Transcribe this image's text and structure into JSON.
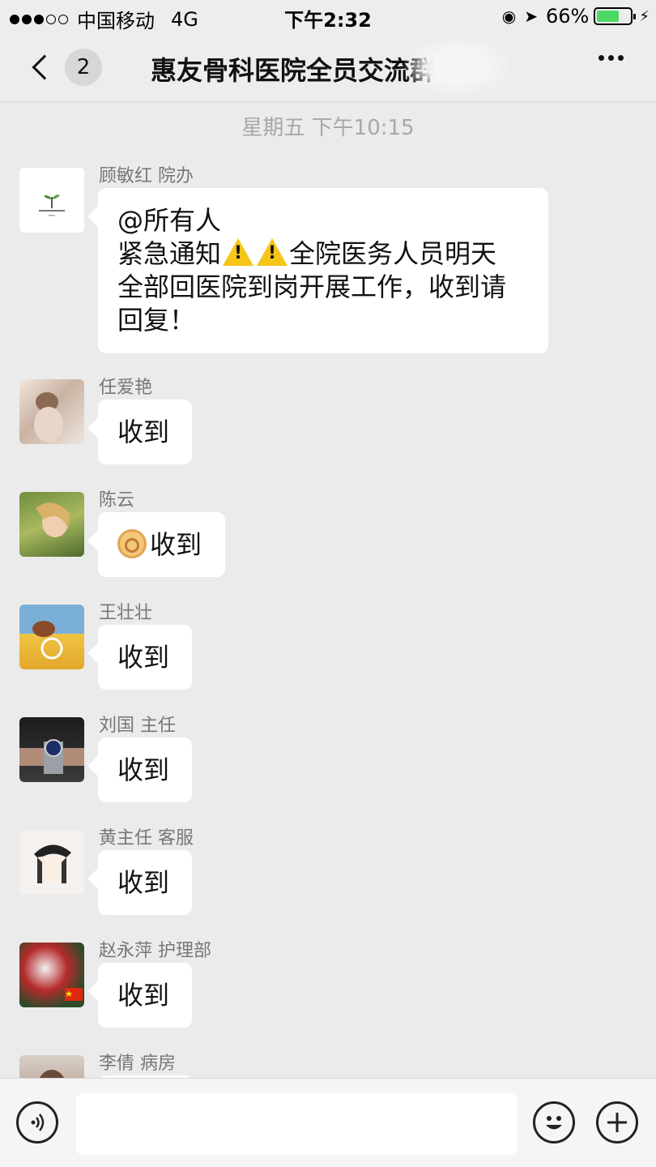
{
  "status_bar": {
    "signal_dots_filled": 3,
    "signal_dots_total": 5,
    "carrier": "中国移动",
    "network": "4G",
    "time": "下午2:32",
    "battery_percent": "66%",
    "battery_level": 0.66,
    "battery_color": "#4cd964"
  },
  "nav": {
    "unread_count": "2",
    "title": "惠友骨科医院全员交流群"
  },
  "chat": {
    "timestamp": "星期五 下午10:15",
    "messages": [
      {
        "sender": "顾敏红 院办",
        "lines": [
          "@所有人",
          "紧急通知",
          "全院医务人员明天",
          "全部回医院到岗开展工作，收到请",
          "回复！"
        ]
      },
      {
        "sender": "任爱艳",
        "text": "收到"
      },
      {
        "sender": "陈云",
        "text": "收到"
      },
      {
        "sender": "王壮壮",
        "text": "收到"
      },
      {
        "sender": "刘国 主任",
        "text": "收到"
      },
      {
        "sender": "黄主任 客服",
        "text": "收到"
      },
      {
        "sender": "赵永萍 护理部",
        "text": "收到"
      },
      {
        "sender": "李倩  病房",
        "text": ""
      }
    ]
  },
  "icons": {
    "voice": "voice-icon",
    "emoji": "emoji-icon",
    "plus": "plus-icon",
    "warning": "warning-icon",
    "ok_hand": "ok-hand-icon"
  }
}
